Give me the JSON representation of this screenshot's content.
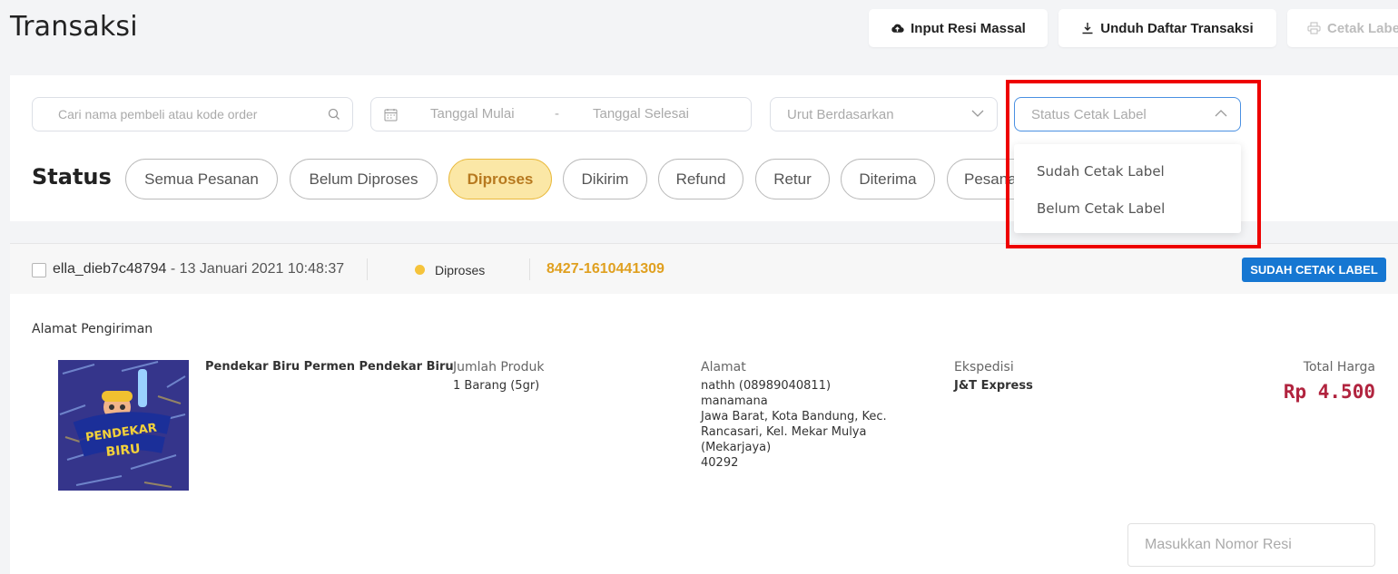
{
  "page": {
    "title": "Transaksi"
  },
  "toolbar": {
    "input_resi": "Input Resi Massal",
    "unduh": "Unduh Daftar Transaksi",
    "cetak": "Cetak Label"
  },
  "filters": {
    "search_placeholder": "Cari nama pembeli atau kode order",
    "date_start": "Tanggal Mulai",
    "date_sep": "-",
    "date_end": "Tanggal Selesai",
    "sort": "Urut Berdasarkan",
    "label_status": "Status Cetak Label"
  },
  "dropdown": {
    "options": [
      "Sudah Cetak Label",
      "Belum Cetak Label"
    ]
  },
  "status": {
    "label": "Status",
    "chips": [
      "Semua Pesanan",
      "Belum Diproses",
      "Diproses",
      "Dikirim",
      "Refund",
      "Retur",
      "Diterima",
      "Pesanan"
    ],
    "active": "Diproses"
  },
  "order": {
    "buyer": "ella_dieb7c48794",
    "date": " - 13 Januari 2021 10:48:37",
    "status": "Diproses",
    "code": "8427-1610441309",
    "label_badge": "SUDAH CETAK LABEL",
    "shipping_title": "Alamat Pengiriman",
    "product_name": "Pendekar Biru Permen Pendekar Biru",
    "qty_header": "Jumlah Produk",
    "qty_value": "1 Barang (5gr)",
    "address_header": "Alamat",
    "address_lines": [
      "nathh (08989040811)",
      "manamana",
      "Jawa Barat, Kota Bandung, Kec.",
      "Rancasari, Kel. Mekar Mulya",
      "(Mekarjaya)",
      "40292"
    ],
    "courier_header": "Ekspedisi",
    "courier_value": "J&T Express",
    "total_header": "Total Harga",
    "total_value": "Rp 4.500",
    "resi_placeholder": "Masukkan Nomor Resi",
    "image_logo_text": "PENDEKAR BIRU"
  },
  "colors": {
    "accent_blue": "#1677d2",
    "active_chip_bg": "#fbe7a6",
    "order_code": "#e0a020",
    "price": "#b1243f",
    "highlight": "#ee0000"
  }
}
